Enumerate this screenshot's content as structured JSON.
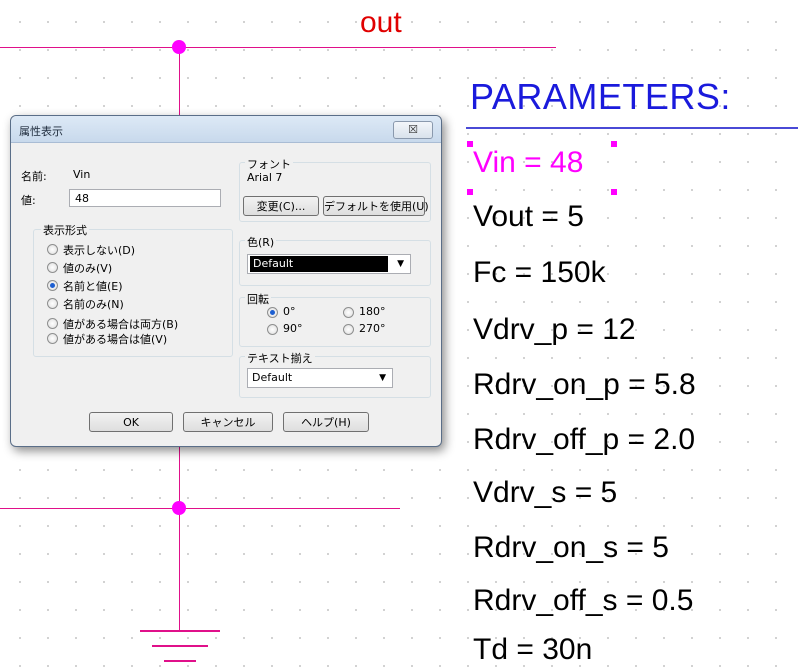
{
  "schematic": {
    "net_label": "out",
    "params_title": "PARAMETERS:",
    "params": [
      "Vin = 48",
      "Vout = 5",
      "Fc = 150k",
      "Vdrv_p = 12",
      "Rdrv_on_p = 5.8",
      "Rdrv_off_p = 2.0",
      "Vdrv_s = 5",
      "Rdrv_on_s = 5",
      "Rdrv_off_s = 0.5",
      "Td = 30n"
    ],
    "colors": {
      "wire": "#e0108a",
      "junction": "#ff00ff",
      "net_label": "#e00000",
      "params_title": "#1a1adc",
      "selected_param": "#ff00ff"
    }
  },
  "dialog": {
    "title": "属性表示",
    "close_label": "☒",
    "name_label": "名前:",
    "name_value": "Vin",
    "value_label": "値:",
    "value_input": "48",
    "display_format_label": "表示形式",
    "display_options": [
      "表示しない(D)",
      "値のみ(V)",
      "名前と値(E)",
      "名前のみ(N)",
      "値がある場合は両方(B)",
      "値がある場合は値(V)"
    ],
    "display_selected": "名前と値(E)",
    "font_label": "フォント",
    "font_value": "Arial 7",
    "change_button": "変更(C)...",
    "default_button": "デフォルトを使用(U)",
    "color_label": "色(R)",
    "color_value": "Default",
    "rotation_label": "回転",
    "rotation_options": [
      "0°",
      "180°",
      "90°",
      "270°"
    ],
    "rotation_selected": "0°",
    "align_label": "テキスト揃え",
    "align_value": "Default",
    "ok_button": "OK",
    "cancel_button": "キャンセル",
    "help_button": "ヘルプ(H)"
  }
}
